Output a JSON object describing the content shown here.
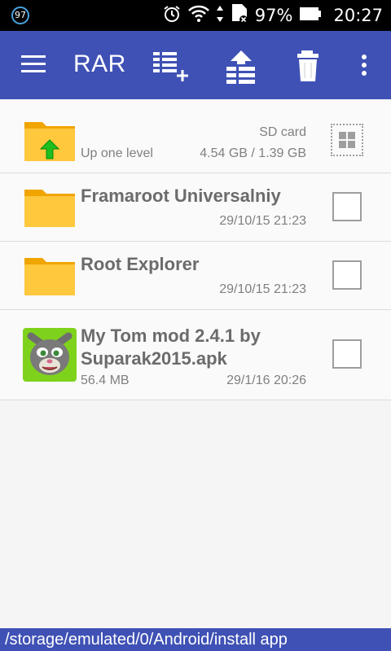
{
  "status_bar": {
    "notification_badge": "97",
    "battery_percent": "97%",
    "time": "20:27",
    "icons": [
      "alarm-icon",
      "wifi-icon",
      "data-arrows-icon",
      "sd-card-icon",
      "battery-icon"
    ]
  },
  "app_bar": {
    "title": "RAR",
    "color": "#3f51b5",
    "actions": [
      "add-to-archive-icon",
      "extract-icon",
      "delete-icon",
      "overflow-menu-icon"
    ]
  },
  "up_level": {
    "label": "Up one level",
    "storage_name": "SD card",
    "storage_space": "4.54 GB / 1.39 GB"
  },
  "files": [
    {
      "name": "Framaroot Universalniy",
      "size": "",
      "date": "29/10/15 21:23",
      "type": "folder"
    },
    {
      "name": "Root Explorer",
      "size": "",
      "date": "29/10/15 21:23",
      "type": "folder"
    },
    {
      "name": "My Tom mod 2.4.1 by Suparak2015.apk",
      "size": "56.4 MB",
      "date": "29/1/16 20:26",
      "type": "apk"
    }
  ],
  "path_bar": {
    "path": "/storage/emulated/0/Android/install app"
  }
}
